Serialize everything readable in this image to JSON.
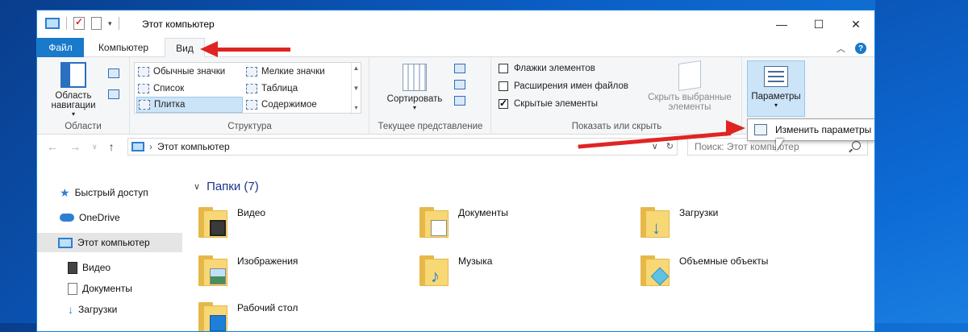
{
  "window": {
    "title": "Этот компьютер",
    "controls": {
      "minimize": "—",
      "maximize": "☐",
      "close": "✕"
    }
  },
  "ribbon_tabs": {
    "file": "Файл",
    "computer": "Компьютер",
    "view": "Вид"
  },
  "ribbon": {
    "areas": {
      "nav_pane_label": "Область навигации",
      "group_label": "Области"
    },
    "layout": {
      "items": [
        "Обычные значки",
        "Мелкие значки",
        "Список",
        "Таблица",
        "Плитка",
        "Содержимое"
      ],
      "selected": "Плитка",
      "group_label": "Структура"
    },
    "current_view": {
      "sort_label": "Сортировать",
      "group_label": "Текущее представление"
    },
    "show_hide": {
      "checkboxes": [
        {
          "label": "Флажки элементов",
          "checked": false
        },
        {
          "label": "Расширения имен файлов",
          "checked": false
        },
        {
          "label": "Скрытые элементы",
          "checked": true
        }
      ],
      "hide_selected_label": "Скрыть выбранные элементы",
      "group_label": "Показать или скрыть"
    },
    "options": {
      "label": "Параметры",
      "dropdown_item": "Изменить параметры папок и поиска"
    }
  },
  "address": {
    "path": "Этот компьютер",
    "search_placeholder": "Поиск: Этот компьютер"
  },
  "sidebar": {
    "items": [
      {
        "label": "Быстрый доступ",
        "icon": "star-icon"
      },
      {
        "label": "OneDrive",
        "icon": "cloud-icon"
      },
      {
        "label": "Этот компьютер",
        "icon": "computer-icon",
        "selected": true
      },
      {
        "label": "Видео",
        "icon": "video-icon"
      },
      {
        "label": "Документы",
        "icon": "document-icon"
      },
      {
        "label": "Загрузки",
        "icon": "download-icon"
      }
    ]
  },
  "main": {
    "section_title": "Папки (7)",
    "folders": [
      "Видео",
      "Документы",
      "Загрузки",
      "Изображения",
      "Музыка",
      "Объемные объекты",
      "Рабочий стол"
    ]
  },
  "colors": {
    "accent": "#1979ca",
    "annotation_arrow": "#e02424",
    "folder": "#f8d775"
  }
}
